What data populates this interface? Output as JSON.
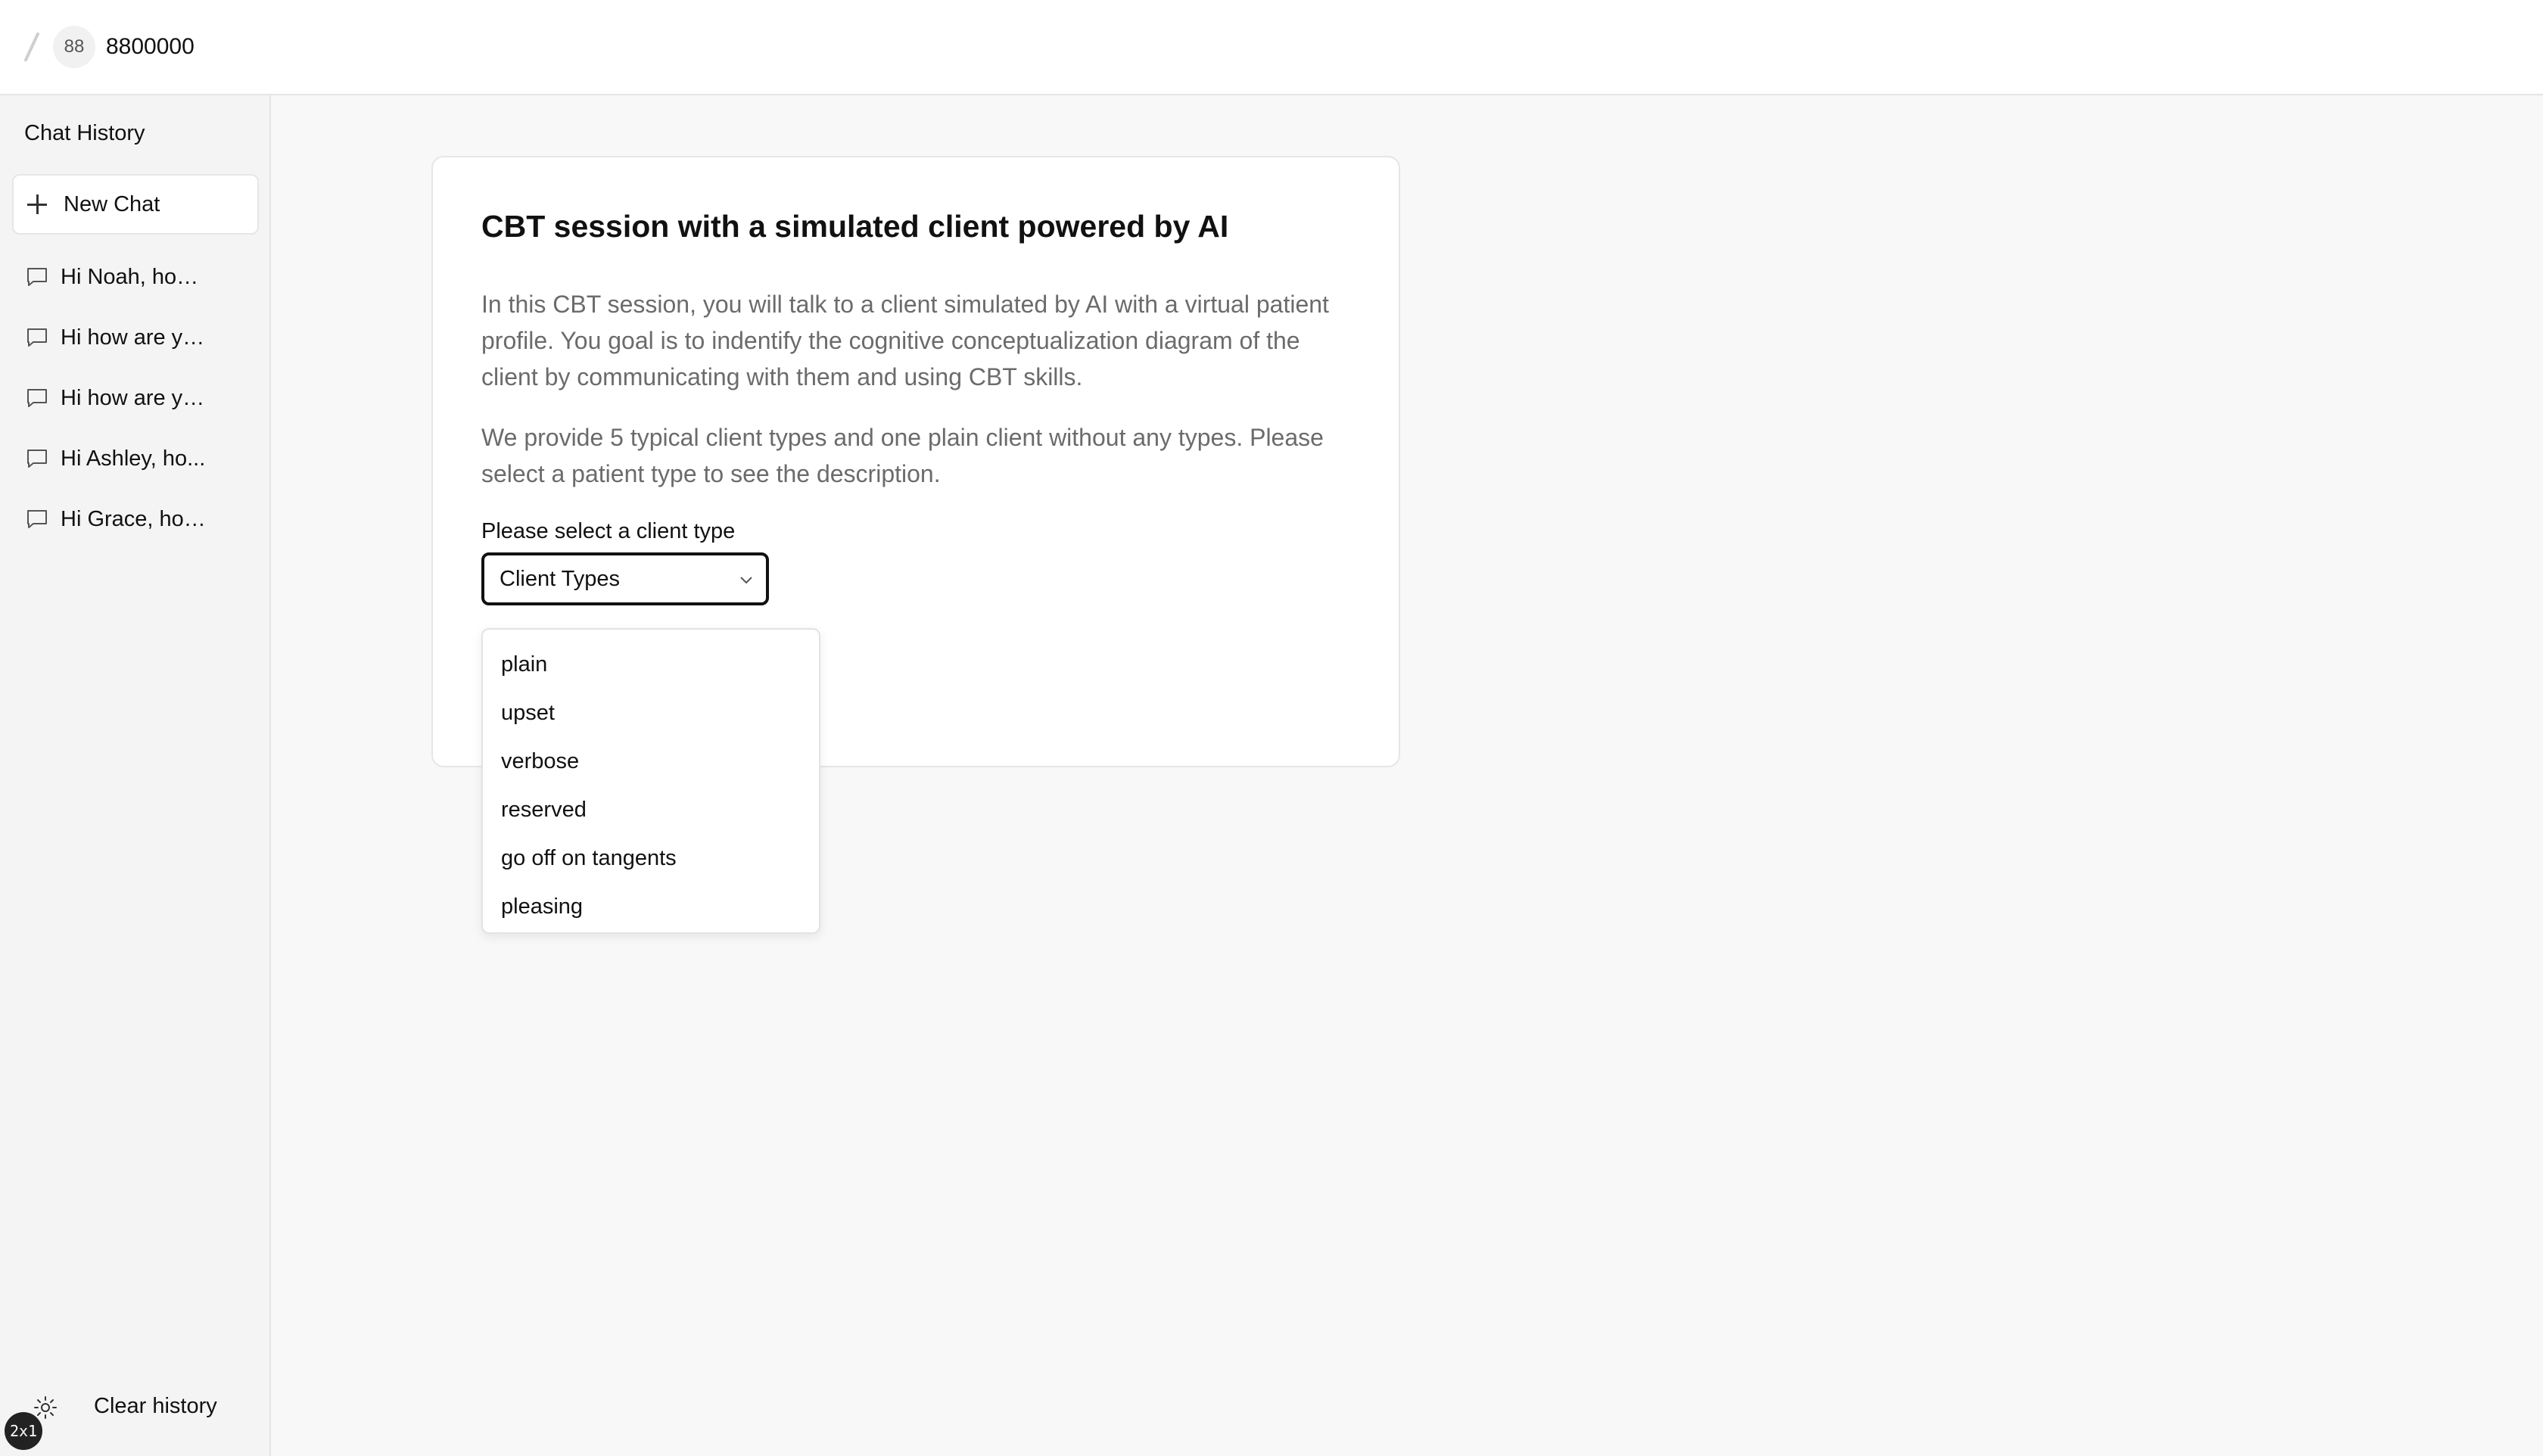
{
  "header": {
    "badge": "88",
    "user_id": "8800000"
  },
  "sidebar": {
    "title": "Chat History",
    "new_chat_label": "New Chat",
    "items": [
      {
        "label": "Hi Noah, how ..."
      },
      {
        "label": "Hi how are yo..."
      },
      {
        "label": "Hi how are yo..."
      },
      {
        "label": "Hi Ashley, ho..."
      },
      {
        "label": "Hi Grace, how..."
      }
    ],
    "clear_history_label": "Clear history",
    "zoom_badge": "2x1"
  },
  "main": {
    "title": "CBT session with a simulated client powered by AI",
    "paragraph1": "In this CBT session, you will talk to a client simulated by AI with a virtual patient profile. You goal is to indentify the cognitive conceptualization diagram of the client by communicating with them and using CBT skills.",
    "paragraph2": "We provide 5 typical client types and one plain client without any types. Please select a patient type to see the description.",
    "select_label": "Please select a client type",
    "select_value": "Client Types",
    "options": [
      {
        "label": "plain"
      },
      {
        "label": "upset"
      },
      {
        "label": "verbose"
      },
      {
        "label": "reserved"
      },
      {
        "label": "go off on tangents"
      },
      {
        "label": "pleasing"
      }
    ]
  },
  "colors": {
    "background": "#f8f8f8",
    "sidebar": "#f4f4f4",
    "card": "#ffffff",
    "muted_text": "#6b6b6b"
  }
}
